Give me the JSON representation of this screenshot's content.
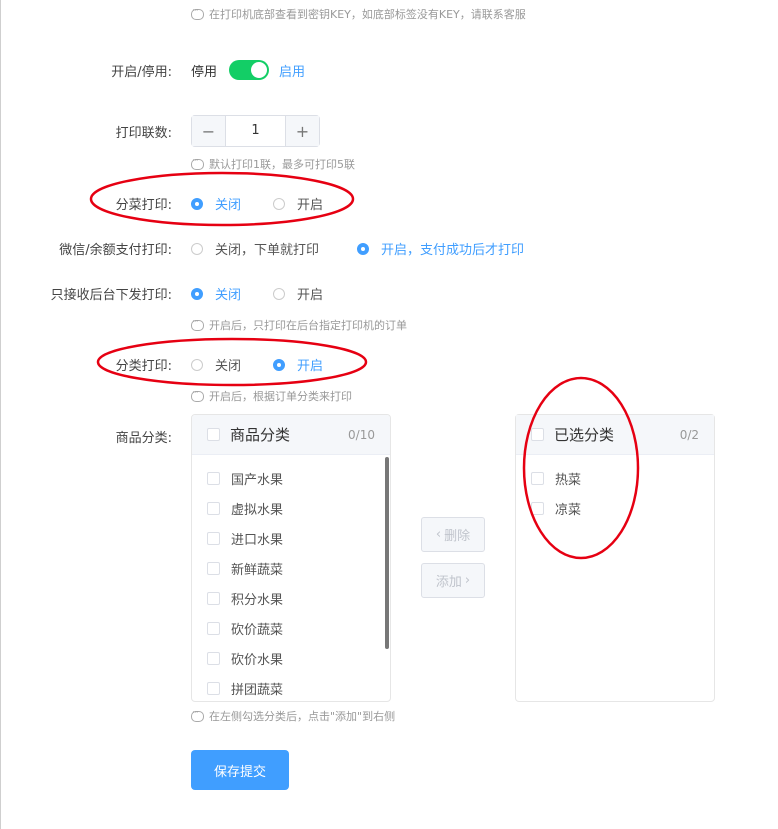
{
  "hints": {
    "top": "在打印机底部查看到密钥KEY，如底部标签没有KEY，请联系客服",
    "copies": "默认打印1联，最多可打印5联",
    "backend": "开启后，只打印在后台指定打印机的订单",
    "category": "开启后，根据订单分类来打印",
    "transfer": "在左侧勾选分类后，点击\"添加\"到右侧"
  },
  "enable": {
    "label": "开启/停用:",
    "off_text": "停用",
    "on_text": "启用",
    "value": true
  },
  "copies": {
    "label": "打印联数:",
    "minus": "−",
    "value": "1",
    "plus": "+"
  },
  "dish_print": {
    "label": "分菜打印:",
    "options": [
      "关闭",
      "开启"
    ],
    "selected": 0
  },
  "pay_print": {
    "label": "微信/余额支付打印:",
    "options": [
      "关闭，下单就打印",
      "开启，支付成功后才打印"
    ],
    "selected": 1
  },
  "backend_print": {
    "label": "只接收后台下发打印:",
    "options": [
      "关闭",
      "开启"
    ],
    "selected": 0
  },
  "category_print": {
    "label": "分类打印:",
    "options": [
      "关闭",
      "开启"
    ],
    "selected": 1
  },
  "goods_category": {
    "label": "商品分类:",
    "left_title": "商品分类",
    "left_count": "0/10",
    "left_items": [
      "国产水果",
      "虚拟水果",
      "进口水果",
      "新鲜蔬菜",
      "积分水果",
      "砍价蔬菜",
      "砍价水果",
      "拼团蔬菜"
    ],
    "right_title": "已选分类",
    "right_count": "0/2",
    "right_items": [
      "热菜",
      "凉菜"
    ],
    "delete_label": "删除",
    "add_label": "添加"
  },
  "save_label": "保存提交",
  "colors": {
    "primary": "#409eff",
    "switch_on": "#13ce66",
    "annotation": "#e60012"
  }
}
